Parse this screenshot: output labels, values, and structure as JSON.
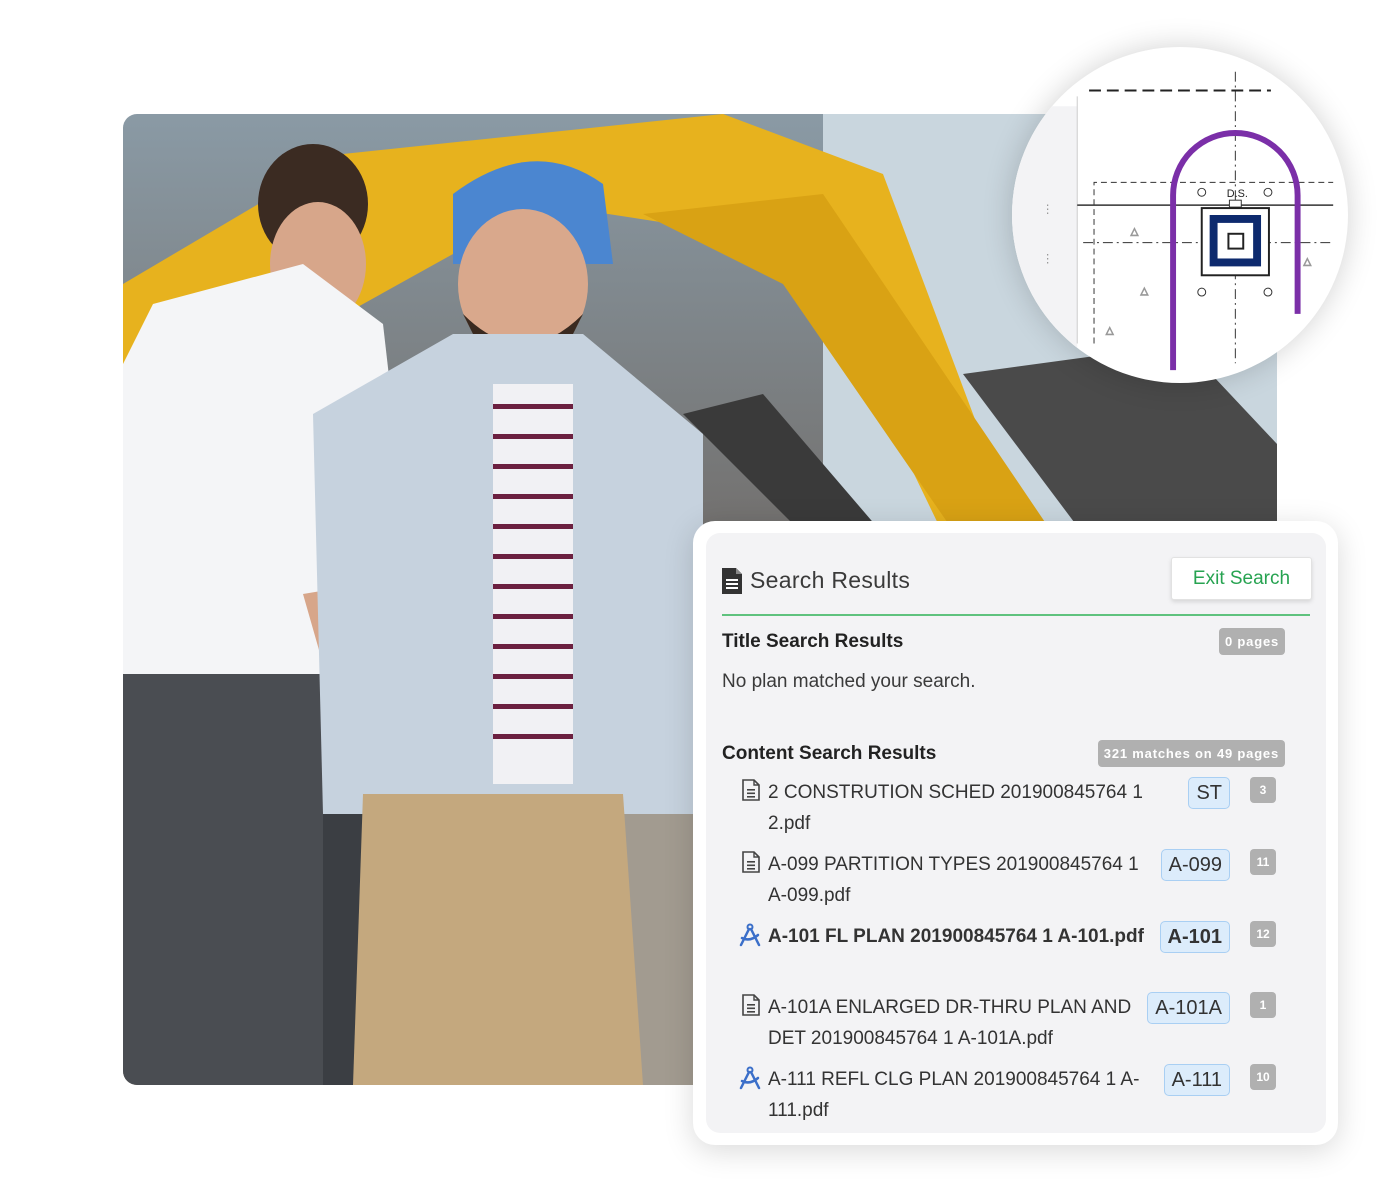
{
  "panel": {
    "title": "Search Results",
    "exit_button": "Exit Search",
    "title_section": {
      "heading": "Title Search Results",
      "badge": "0 pages",
      "empty_message": "No plan matched your search."
    },
    "content_section": {
      "heading": "Content Search Results",
      "badge": "321 matches on 49 pages",
      "results": [
        {
          "icon": "document-icon",
          "name": "2 CONSTRUTION SCHED 201900845764 1 2.pdf",
          "tag": "ST",
          "count": "3",
          "bold": false
        },
        {
          "icon": "document-icon",
          "name": "A-099 PARTITION TYPES 201900845764 1 A-099.pdf",
          "tag": "A-099",
          "count": "11",
          "bold": false
        },
        {
          "icon": "drafting-compass-icon",
          "name": "A-101 FL PLAN 201900845764 1 A-101.pdf",
          "tag": "A-101",
          "count": "12",
          "bold": true
        },
        {
          "icon": "document-icon",
          "name": "A-101A ENLARGED DR-THRU PLAN AND DET 201900845764 1 A-101A.pdf",
          "tag": "A-101A",
          "count": "1",
          "bold": false
        },
        {
          "icon": "drafting-compass-icon",
          "name": "A-111 REFL CLG PLAN 201900845764 1 A-111.pdf",
          "tag": "A-111",
          "count": "10",
          "bold": false
        }
      ]
    }
  },
  "blueprint": {
    "label": "D.S."
  },
  "colors": {
    "accent_green": "#27a351",
    "tag_blue": "#dcecfb",
    "compass_blue": "#3b6fc9",
    "blueprint_purple": "#7b2fa8",
    "blueprint_navy": "#0d2a6e"
  }
}
